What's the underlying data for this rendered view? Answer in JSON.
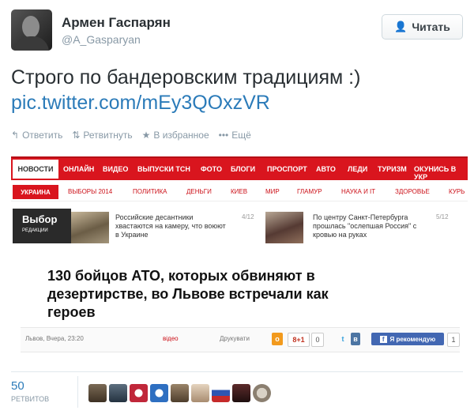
{
  "author": {
    "name": "Армен Гаспарян",
    "handle": "@A_Gasparyan"
  },
  "follow_button": {
    "label": "Читать",
    "icon": "add-user-icon"
  },
  "tweet": {
    "text": "Строго по бандеровским традициям :)",
    "link": "pic.twitter.com/mEy3QOxzVR"
  },
  "actions": [
    {
      "icon": "reply-icon",
      "glyph": "↰",
      "label": "Ответить"
    },
    {
      "icon": "retweet-icon",
      "glyph": "⇅",
      "label": "Ретвитнуть"
    },
    {
      "icon": "star-icon",
      "glyph": "★",
      "label": "В избранное"
    },
    {
      "icon": "more-icon",
      "glyph": "•••",
      "label": "Ещё"
    }
  ],
  "embed": {
    "nav_main": [
      "НОВОСТИ",
      "ОНЛАЙН",
      "ВИДЕО",
      "ВЫПУСКИ ТСН",
      "ФОТО",
      "БЛОГИ",
      "ПРОСПОРТ",
      "АВТО",
      "ЛЕДИ",
      "ТУРИЗМ",
      "ОКУНИСЬ В УКР"
    ],
    "nav_sub": [
      "УКРАИНА",
      "ВЫБОРЫ 2014",
      "ПОЛИТИКА",
      "ДЕНЬГИ",
      "КИЕВ",
      "МИР",
      "ГЛАМУР",
      "НАУКА И IT",
      "ЗДОРОВЬЕ",
      "КУРЬ"
    ],
    "choice": {
      "title": "Выбор",
      "subtitle": "РЕДАКЦИИ"
    },
    "news": [
      {
        "text": "Российские десантники хвастаются на камеру, что воюют в Украине",
        "count": "4/12"
      },
      {
        "text": "По центру Санкт-Петербурга прошлась \"ослепшая Россия\" с кровью на руках",
        "count": "5/12"
      }
    ],
    "headline": "130 бойцов АТО, которых обвиняют в дезертирстве, во Львове встречали как героев",
    "meta": {
      "date": "Львов, Вчера, 23:20",
      "video": "відео",
      "print": "Друкувати",
      "gplus": "8+1",
      "gplus_count": "0",
      "recommend": "Я рекомендую",
      "recommend_count": "1"
    }
  },
  "retweets": {
    "count": "50",
    "label": "РЕТВИТОВ"
  },
  "colors": {
    "accent": "#d9151e",
    "link": "#2b7bb9",
    "muted": "#8899a6"
  }
}
